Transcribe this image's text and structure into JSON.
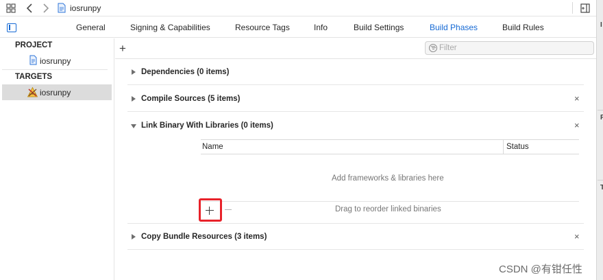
{
  "topbar": {
    "breadcrumb": "iosrunpy"
  },
  "tabs": [
    {
      "label": "General",
      "active": false
    },
    {
      "label": "Signing & Capabilities",
      "active": false
    },
    {
      "label": "Resource Tags",
      "active": false
    },
    {
      "label": "Info",
      "active": false
    },
    {
      "label": "Build Settings",
      "active": false
    },
    {
      "label": "Build Phases",
      "active": true
    },
    {
      "label": "Build Rules",
      "active": false
    }
  ],
  "navigator": {
    "project_header": "PROJECT",
    "project_item": "iosrunpy",
    "targets_header": "TARGETS",
    "target_item": "iosrunpy"
  },
  "toolbar": {
    "add_symbol": "+",
    "filter_placeholder": "Filter"
  },
  "phases": [
    {
      "title": "Dependencies (0 items)",
      "expanded": false,
      "removable": false
    },
    {
      "title": "Compile Sources (5 items)",
      "expanded": false,
      "removable": true
    },
    {
      "title": "Link Binary With Libraries (0 items)",
      "expanded": true,
      "removable": true
    },
    {
      "title": "Copy Bundle Resources (3 items)",
      "expanded": false,
      "removable": true
    }
  ],
  "close_symbol": "×",
  "library_table": {
    "columns": [
      "Name",
      "Status"
    ],
    "empty_hint": "Add frameworks & libraries here",
    "drag_hint": "Drag to reorder linked binaries"
  },
  "right_strip_letters": [
    "I",
    "F",
    "T"
  ],
  "watermark": "CSDN @有钳任性",
  "colors": {
    "accent": "#1569d4",
    "highlight": "#e8222a",
    "selection": "#dcdcdc"
  }
}
